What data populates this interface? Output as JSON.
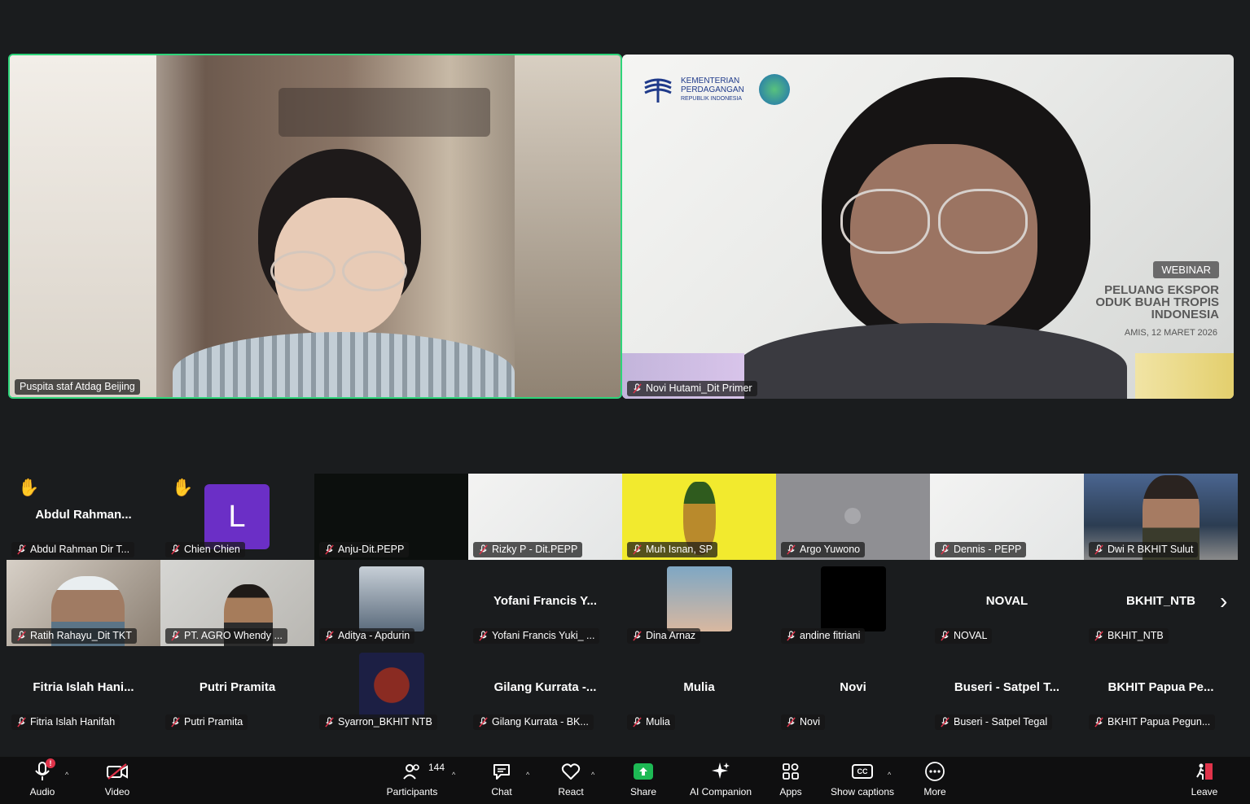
{
  "speakers": {
    "left_name": "Puspita staf Atdag Beijing",
    "right_name": "Novi Hutami_Dit Primer"
  },
  "slide": {
    "ministry_line1": "KEMENTERIAN",
    "ministry_line2": "PERDAGANGAN",
    "ministry_line3": "REPUBLIK INDONESIA",
    "badge": "WEBINAR",
    "title_1": "PELUANG EKSPOR",
    "title_2": "ODUK BUAH TROPIS",
    "title_3": "INDONESIA",
    "date": "AMIS, 12 MARET 2026"
  },
  "gallery": {
    "row1": [
      {
        "name": "Abdul Rahman Dir T...",
        "big": "Abdul  Rahman...",
        "hand": "✋"
      },
      {
        "name": "Chien Chien",
        "avatar": "L",
        "hand": "✋"
      },
      {
        "name": "Anju-Dit.PEPP"
      },
      {
        "name": "Rizky P - Dit.PEPP"
      },
      {
        "name": "Muh Isnan, SP"
      },
      {
        "name": "Argo Yuwono"
      },
      {
        "name": "Dennis - PEPP"
      },
      {
        "name": "Dwi R BKHIT Sulut"
      }
    ],
    "row2": [
      {
        "name": "Ratih Rahayu_Dit TKT"
      },
      {
        "name": "PT. AGRO Whendy ..."
      },
      {
        "name": "Aditya - Apdurin"
      },
      {
        "name": "Yofani Francis Yuki_ ...",
        "big": "Yofani Francis Y..."
      },
      {
        "name": "Dina Arnaz"
      },
      {
        "name": "andine fitriani"
      },
      {
        "name": "NOVAL",
        "big": "NOVAL"
      },
      {
        "name": "BKHIT_NTB",
        "big": "BKHIT_NTB"
      }
    ],
    "row3": [
      {
        "name": "Fitria Islah Hanifah",
        "big": "Fitria  Islah  Hani..."
      },
      {
        "name": "Putri Pramita",
        "big": "Putri Pramita"
      },
      {
        "name": "Syarron_BKHIT NTB"
      },
      {
        "name": "Gilang Kurrata - BK...",
        "big": "Gilang  Kurrata  -..."
      },
      {
        "name": "Mulia",
        "big": "Mulia"
      },
      {
        "name": "Novi",
        "big": "Novi"
      },
      {
        "name": "Buseri - Satpel Tegal",
        "big": "Buseri - Satpel T..."
      },
      {
        "name": "BKHIT Papua Pegun...",
        "big": "BKHIT  Papua  Pe..."
      }
    ],
    "next_glyph": "›"
  },
  "toolbar": {
    "audio": "Audio",
    "audio_badge": "!",
    "video": "Video",
    "participants": "Participants",
    "participants_count": "144",
    "chat": "Chat",
    "react": "React",
    "share": "Share",
    "ai": "AI Companion",
    "apps": "Apps",
    "captions": "Show captions",
    "more": "More",
    "leave": "Leave",
    "caret": "^"
  },
  "colors": {
    "active_speaker_border": "#2ed47a",
    "share_green": "#1db954",
    "leave_red": "#e0334a",
    "avatar_purple": "#6b2fc6"
  }
}
